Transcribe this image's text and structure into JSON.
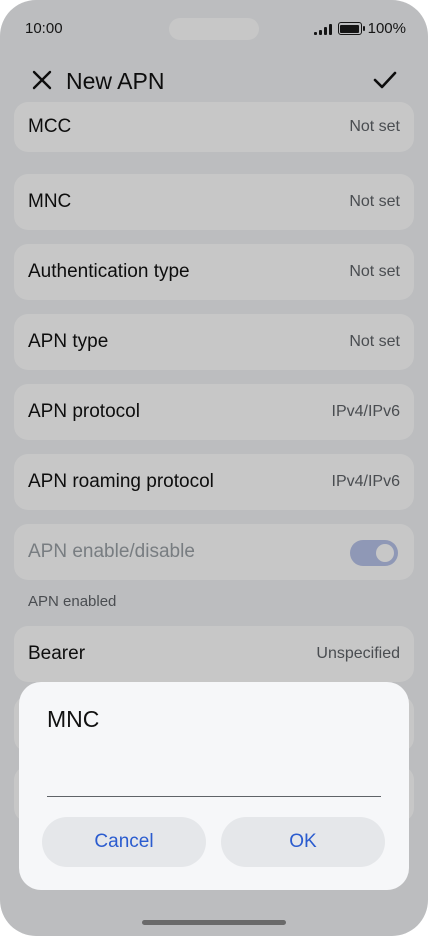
{
  "status": {
    "time": "10:00",
    "battery": "100%"
  },
  "appbar": {
    "title": "New APN",
    "close_icon": "close-icon",
    "confirm_icon": "check-icon"
  },
  "settings": [
    {
      "label": "MCC",
      "value": "Not set"
    },
    {
      "label": "MNC",
      "value": "Not set"
    },
    {
      "label": "Authentication type",
      "value": "Not set"
    },
    {
      "label": "APN type",
      "value": "Not set"
    },
    {
      "label": "APN protocol",
      "value": "IPv4/IPv6"
    },
    {
      "label": "APN roaming protocol",
      "value": "IPv4/IPv6"
    }
  ],
  "apn_toggle": {
    "label": "APN enable/disable",
    "note": "APN enabled",
    "enabled": true
  },
  "bearer": {
    "label": "Bearer",
    "value": "Unspecified"
  },
  "dialog": {
    "title": "MNC",
    "input_value": "",
    "cancel_label": "Cancel",
    "ok_label": "OK"
  },
  "colors": {
    "accent": "#2b5ccf",
    "toggle_track": "#b8c3e9",
    "background": "#f1f3f5"
  }
}
